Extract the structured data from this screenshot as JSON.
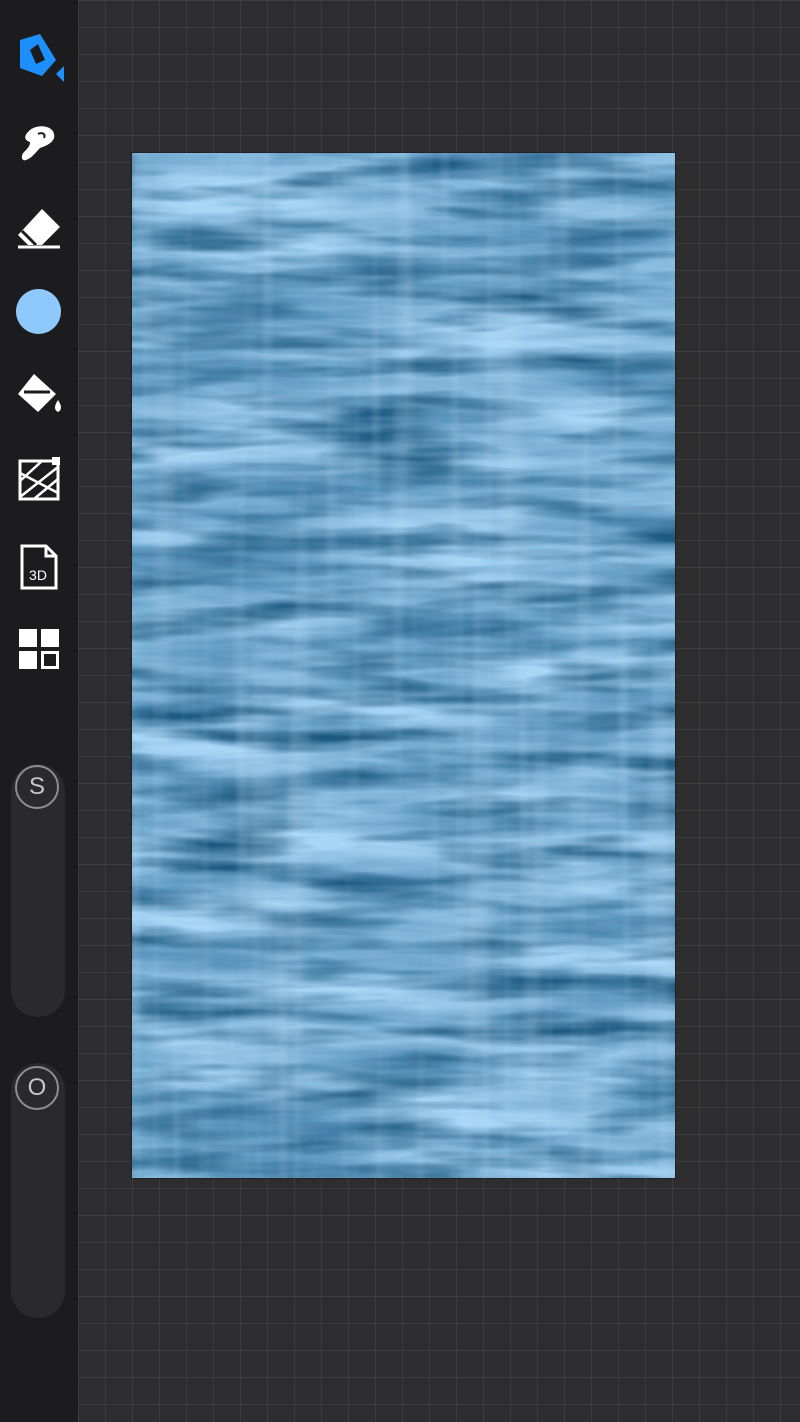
{
  "toolbar": {
    "tools": [
      {
        "name": "brush-library",
        "icon": "pen-nib-icon",
        "active": true
      },
      {
        "name": "smudge",
        "icon": "smudge-finger-icon",
        "active": false
      },
      {
        "name": "eraser",
        "icon": "eraser-icon",
        "active": false
      },
      {
        "name": "color",
        "icon": "color-swatch",
        "active": false
      },
      {
        "name": "fill",
        "icon": "paint-bucket-icon",
        "active": false
      },
      {
        "name": "texture-paint",
        "icon": "texture-grid-icon",
        "active": false
      },
      {
        "name": "3d-model",
        "icon": "3d-file-icon",
        "active": false
      },
      {
        "name": "layers",
        "icon": "layers-grid-icon",
        "active": false
      }
    ],
    "icon_3d_label": "3D",
    "current_color": "#8fc8fb",
    "active_tool_color": "#1e8fff",
    "icon_color": "#ffffff"
  },
  "sliders": {
    "size": {
      "label": "S",
      "value": 0.0
    },
    "opacity": {
      "label": "O",
      "value": 0.0
    }
  },
  "canvas": {
    "texture_colors": {
      "light": "#a8d6f7",
      "mid": "#5b93bd",
      "dark": "#1f5a82",
      "deep": "#143f60"
    }
  }
}
